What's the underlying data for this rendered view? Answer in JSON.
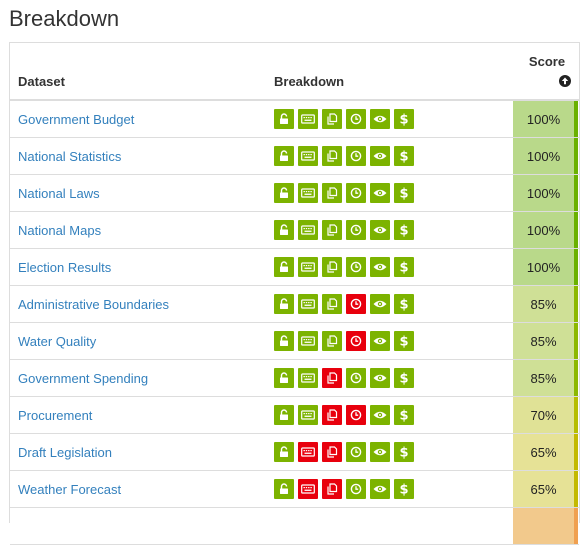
{
  "page": {
    "title": "Breakdown"
  },
  "table": {
    "headers": {
      "dataset": "Dataset",
      "breakdown": "Breakdown",
      "score": "Score"
    },
    "sort_icon": "circle-arrow-up-icon",
    "icon_names": [
      "unlock-icon",
      "keyboard-icon",
      "copy-icon",
      "clock-icon",
      "eye-icon",
      "dollar-icon"
    ],
    "colors": {
      "pass": "#7cb300",
      "fail": "#e8000d",
      "link": "#3380bd"
    },
    "rows": [
      {
        "name": "Government Budget",
        "score": "100%",
        "icons": [
          1,
          1,
          1,
          1,
          1,
          1
        ],
        "score_color": "#b9d98a",
        "edge_color": "#6ab100"
      },
      {
        "name": "National Statistics",
        "score": "100%",
        "icons": [
          1,
          1,
          1,
          1,
          1,
          1
        ],
        "score_color": "#b9d98a",
        "edge_color": "#6ab100"
      },
      {
        "name": "National Laws",
        "score": "100%",
        "icons": [
          1,
          1,
          1,
          1,
          1,
          1
        ],
        "score_color": "#b9d98a",
        "edge_color": "#6ab100"
      },
      {
        "name": "National Maps",
        "score": "100%",
        "icons": [
          1,
          1,
          1,
          1,
          1,
          1
        ],
        "score_color": "#b9d98a",
        "edge_color": "#6ab100"
      },
      {
        "name": "Election Results",
        "score": "100%",
        "icons": [
          1,
          1,
          1,
          1,
          1,
          1
        ],
        "score_color": "#b9d98a",
        "edge_color": "#6ab100"
      },
      {
        "name": "Administrative Boundaries",
        "score": "85%",
        "icons": [
          1,
          1,
          1,
          0,
          1,
          1
        ],
        "score_color": "#cfe096",
        "edge_color": "#8cb800"
      },
      {
        "name": "Water Quality",
        "score": "85%",
        "icons": [
          1,
          1,
          1,
          0,
          1,
          1
        ],
        "score_color": "#cfe096",
        "edge_color": "#8cb800"
      },
      {
        "name": "Government Spending",
        "score": "85%",
        "icons": [
          1,
          1,
          0,
          1,
          1,
          1
        ],
        "score_color": "#cfe096",
        "edge_color": "#8cb800"
      },
      {
        "name": "Procurement",
        "score": "70%",
        "icons": [
          1,
          1,
          0,
          0,
          1,
          1
        ],
        "score_color": "#e0e296",
        "edge_color": "#b6bd00"
      },
      {
        "name": "Draft Legislation",
        "score": "65%",
        "icons": [
          1,
          0,
          0,
          1,
          1,
          1
        ],
        "score_color": "#e6e296",
        "edge_color": "#c3b900"
      },
      {
        "name": "Weather Forecast",
        "score": "65%",
        "icons": [
          1,
          0,
          0,
          1,
          1,
          1
        ],
        "score_color": "#e6e296",
        "edge_color": "#c3b900"
      }
    ],
    "partial_row": {
      "score_color": "#f2c98c",
      "edge_color": "#f0a050"
    }
  }
}
